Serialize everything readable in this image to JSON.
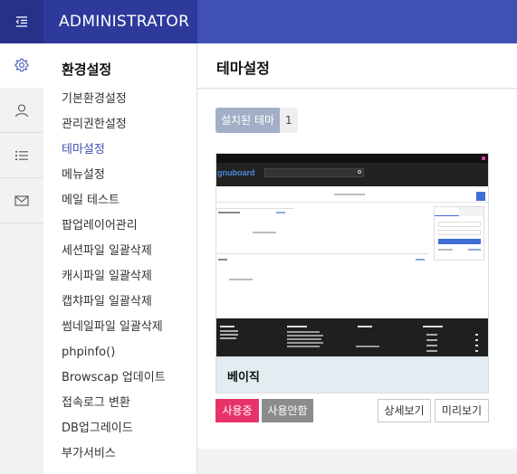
{
  "app": {
    "title": "ADMINISTRATOR"
  },
  "rail": {
    "items": [
      {
        "icon": "gear-icon",
        "active": true
      },
      {
        "icon": "user-icon",
        "active": false
      },
      {
        "icon": "list-icon",
        "active": false
      },
      {
        "icon": "mail-icon",
        "active": false
      }
    ]
  },
  "submenu": {
    "title": "환경설정",
    "items": [
      "기본환경설정",
      "관리권한설정",
      "테마설정",
      "메뉴설정",
      "메일 테스트",
      "팝업레이어관리",
      "세션파일 일괄삭제",
      "캐시파일 일괄삭제",
      "캡챠파일 일괄삭제",
      "썸네일파일 일괄삭제",
      "phpinfo()",
      "Browscap 업데이트",
      "접속로그 변환",
      "DB업그레이드",
      "부가서비스"
    ],
    "active_index": 2
  },
  "page": {
    "title": "테마설정",
    "installed_label": "설치된 테마",
    "installed_count": "1"
  },
  "theme": {
    "name": "베이직",
    "preview": {
      "logo": "gnuboard"
    },
    "buttons": {
      "active": "사용중",
      "deactivate": "사용안함",
      "detail": "상세보기",
      "preview": "미리보기"
    }
  },
  "colors": {
    "topbar": "#3f51b5",
    "accent": "#3f51b5",
    "active_button": "#e8336a",
    "installed_label": "#a3afc7"
  }
}
